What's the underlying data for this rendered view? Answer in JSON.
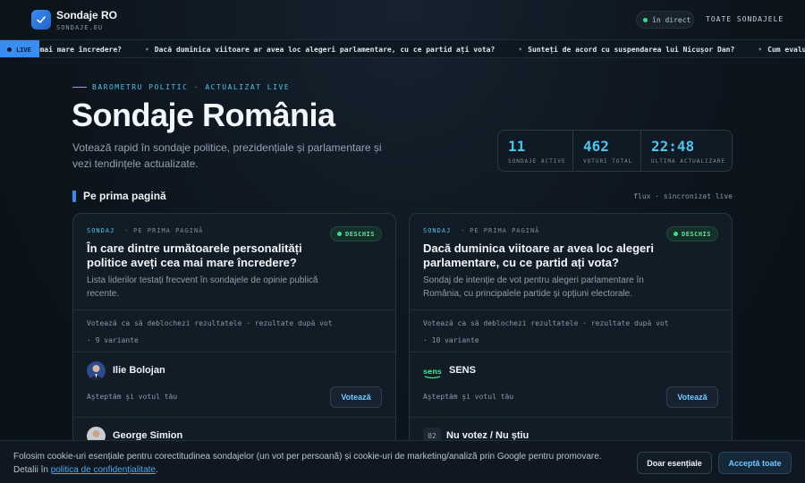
{
  "header": {
    "brand_name": "Sondaje RO",
    "brand_sub": "SONDAJE.EU",
    "live_label": "în direct",
    "all_polls_link": "TOATE SONDAJELE"
  },
  "ticker": {
    "live_tag": "LIVE",
    "items": [
      "ra mai mare încredere?",
      "Dacă duminica viitoare ar avea loc alegeri parlamentare, cu ce partid ați vota?",
      "Sunteți de acord cu suspendarea lui Nicușor Dan?",
      "Cum evaluați activitatea"
    ]
  },
  "hero": {
    "eyebrow": "BAROMETRU POLITIC · ACTUALIZAT LIVE",
    "title": "Sondaje România",
    "description": "Votează rapid în sondaje politice, prezidențiale și parlamentare și vezi tendințele actualizate."
  },
  "stats": [
    {
      "value": "11",
      "label": "SONDAJE ACTIVE"
    },
    {
      "value": "462",
      "label": "VOTURI TOTAL"
    },
    {
      "value": "22:48",
      "label": "ULTIMA ACTUALIZARE"
    }
  ],
  "section": {
    "title": "Pe prima pagină",
    "flux": "flux · sincronizat live"
  },
  "cards": [
    {
      "meta_tag": "SONDAJ",
      "meta_rest": "·  PE PRIMA PAGINĂ",
      "badge": "DESCHIS",
      "question": "În care dintre următoarele personalități politice aveți cea mai mare încredere?",
      "description": "Lista liderilor testați frecvent în sondajele de opinie publică recente.",
      "info_line": "Votează ca să deblochezi rezultatele  ·  rezultate după vot",
      "variants": "·  9 variante",
      "options": [
        {
          "name": "Ilie Bolojan",
          "wait": "Așteptăm și votul tău",
          "vote_label": "Votează"
        },
        {
          "name": "George Simion"
        }
      ]
    },
    {
      "meta_tag": "SONDAJ",
      "meta_rest": "·  PE PRIMA PAGINĂ",
      "badge": "DESCHIS",
      "question": "Dacă duminica viitoare ar avea loc alegeri parlamentare, cu ce partid ați vota?",
      "description": "Sondaj de intenție de vot pentru alegeri parlamentare în România, cu principalele partide și opțiuni electorale.",
      "info_line": "Votează ca să deblochezi rezultatele  ·  rezultate după vot",
      "variants": "·  10 variante",
      "options": [
        {
          "name": "SENS",
          "logo_text": "sens",
          "wait": "Așteptăm și votul tău",
          "vote_label": "Votează"
        },
        {
          "name": "Nu votez / Nu știu",
          "number": "02"
        }
      ]
    }
  ],
  "cookie": {
    "text": "Folosim cookie-uri esențiale pentru corectitudinea sondajelor (un vot per persoană) și cookie-uri de marketing/analiză prin Google pentru promovare. Detalii în ",
    "link_text": "politica de confidențialitate",
    "end": ".",
    "essential_label": "Doar esențiale",
    "accept_label": "Acceptă toate"
  },
  "colors": {
    "accent": "#3b8cf0",
    "cyan": "#4fc3e8",
    "live_green": "#3ddc84",
    "background": "#0c141c"
  }
}
